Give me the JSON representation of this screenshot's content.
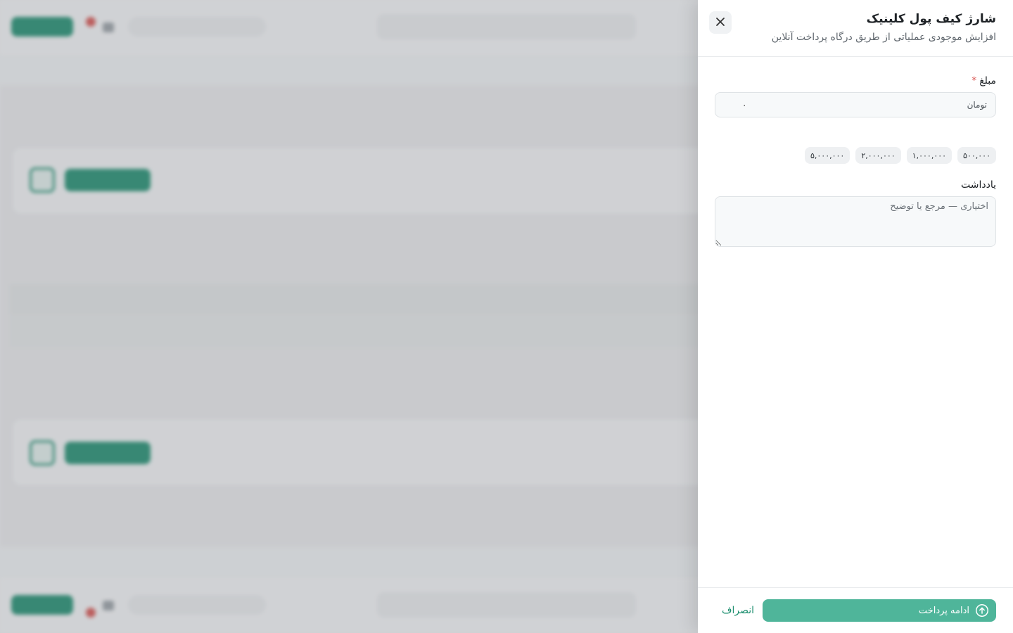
{
  "drawer": {
    "title": "شارژ کیف پول کلینیک",
    "subtitle": "افزایش موجودی عملیاتی از طریق درگاه پرداخت آنلاین",
    "close_icon": "close-icon"
  },
  "amount": {
    "label": "مبلغ",
    "required_mark": "*",
    "unit": "تومان",
    "value": "۰"
  },
  "presets": [
    "۵۰۰,۰۰۰",
    "۱,۰۰۰,۰۰۰",
    "۲,۰۰۰,۰۰۰",
    "۵,۰۰۰,۰۰۰"
  ],
  "note": {
    "label": "یادداشت",
    "placeholder": "اختیاری — مرجع یا توضیح"
  },
  "footer": {
    "pay_label": "ادامه پرداخت",
    "pay_icon": "arrow-up-circle-icon",
    "cancel_label": "انصراف"
  },
  "colors": {
    "accent": "#1d8f6f",
    "pay_button": "#4fb59a",
    "required": "#d9534f"
  }
}
